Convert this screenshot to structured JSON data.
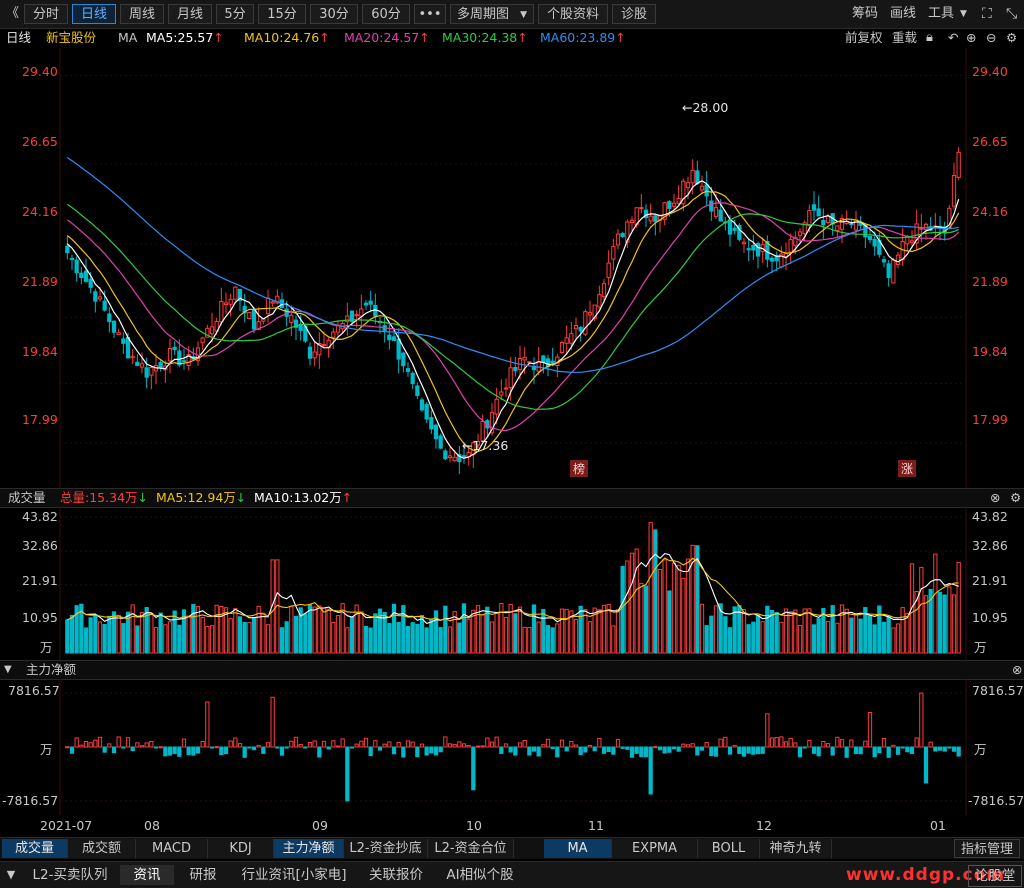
{
  "toolbar": {
    "back": "《",
    "periods": [
      "分时",
      "日线",
      "周线",
      "月线",
      "5分",
      "15分",
      "30分",
      "60分"
    ],
    "active_period": "日线",
    "more": "•••",
    "multi_period": "多周期图",
    "stock_info": "个股资料",
    "diagnose": "诊股",
    "right_items": [
      "筹码",
      "画线",
      "工具"
    ]
  },
  "legend": {
    "period": "日线",
    "stock_name": "新宝股份",
    "indicator": "MA",
    "ma5": "MA5:25.57",
    "ma10": "MA10:24.76",
    "ma20": "MA20:24.57",
    "ma30": "MA30:24.38",
    "ma60": "MA60:23.89",
    "adjust": "前复权",
    "redraw": "重载"
  },
  "colors": {
    "up": "#ff3b3b",
    "down": "#00b8c8",
    "ma5": "#ffffff",
    "ma10": "#f2c311",
    "ma20": "#e040b0",
    "ma30": "#2ecc40",
    "ma60": "#2a8ff7",
    "grid": "#2a0000"
  },
  "price_axis": {
    "ticks": [
      "29.40",
      "26.65",
      "24.16",
      "21.89",
      "19.84",
      "17.99"
    ]
  },
  "annotations": {
    "high": "28.00",
    "low": "17.36",
    "tag1": "榜",
    "tag2": "涨"
  },
  "volume_header": {
    "label": "成交量",
    "total": "总量:15.34万",
    "ma5": "MA5:12.94万",
    "ma10": "MA10:13.02万"
  },
  "volume_axis": {
    "ticks": [
      "43.82",
      "32.86",
      "21.91",
      "10.95"
    ],
    "unit": "万"
  },
  "flow_header": {
    "label": "主力净额"
  },
  "flow_axis": {
    "top": "7816.57",
    "unit": "万",
    "bottom": "-7816.57"
  },
  "date_axis": {
    "labels": [
      "2021-07",
      "08",
      "09",
      "10",
      "11",
      "12",
      "01"
    ]
  },
  "bottom_tabs": [
    "成交量",
    "成交额",
    "MACD",
    "KDJ",
    "主力净额",
    "L2-资金抄底",
    "L2-资金合位"
  ],
  "bottom_tabs_selected": "成交量",
  "bottom_tabs_selected2": "主力净额",
  "overlay_tabs": [
    "MA",
    "EXPMA",
    "BOLL",
    "神奇九转"
  ],
  "overlay_selected": "MA",
  "indicator_manage": "指标管理",
  "nav_tabs": [
    "L2-买卖队列",
    "资讯",
    "研报",
    "行业资讯[小家电]",
    "关联报价",
    "AI相似个股"
  ],
  "nav_selected": "资讯",
  "forum": "论股堂",
  "watermark": "www.ddgp.com",
  "chart_data": [
    {
      "type": "candlestick",
      "title": "日线 新宝股份",
      "x_range": [
        "2021-07",
        "2022-01"
      ],
      "ylim": [
        17.36,
        29.4
      ],
      "y_ticks": [
        29.4,
        26.65,
        24.16,
        21.89,
        19.84,
        17.99
      ],
      "high_marker": 28.0,
      "low_marker": 17.36,
      "ma_values": {
        "MA5": 25.57,
        "MA10": 24.76,
        "MA20": 24.57,
        "MA30": 24.38,
        "MA60": 23.89
      }
    },
    {
      "type": "bar",
      "title": "成交量",
      "ylim": [
        0,
        43.82
      ],
      "y_ticks": [
        43.82,
        32.86,
        21.91,
        10.95
      ],
      "unit": "万",
      "latest_total": 15.34
    },
    {
      "type": "bar",
      "title": "主力净额",
      "ylim": [
        -7816.57,
        7816.57
      ],
      "unit": "万"
    }
  ]
}
